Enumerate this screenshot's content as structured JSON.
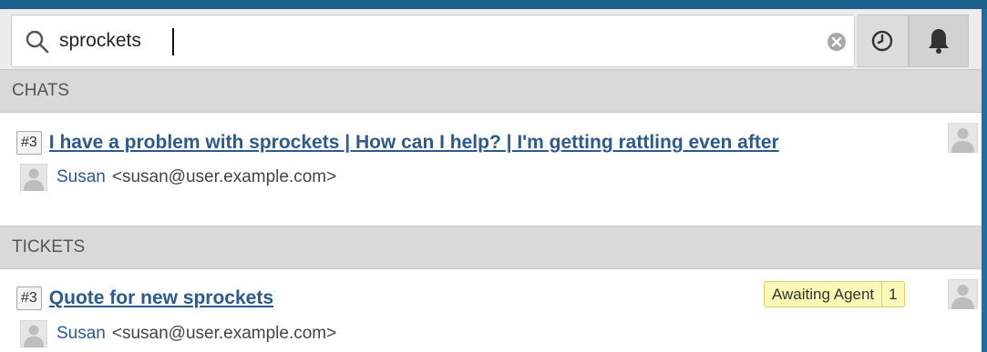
{
  "search": {
    "value": "sprockets",
    "clear_icon": "clear-circle-icon",
    "search_icon": "magnifier-icon",
    "history_icon": "clock-icon",
    "notifications_icon": "bell-icon"
  },
  "sections": {
    "chats": {
      "header": "CHATS",
      "items": [
        {
          "id": "#3",
          "title": "I have a problem with sprockets | How can I help? | I'm getting rattling even after",
          "person_name": "Susan",
          "person_email": "<susan@user.example.com>"
        }
      ]
    },
    "tickets": {
      "header": "TICKETS",
      "items": [
        {
          "id": "#3",
          "title": "Quote for new sprockets",
          "status_label": "Awaiting Agent",
          "status_count": "1",
          "person_name": "Susan",
          "person_email": "<susan@user.example.com>"
        }
      ]
    }
  },
  "colors": {
    "link": "#2d5a8e",
    "status_badge_bg": "#fbf7b6",
    "section_header_bg": "#d9d9d9",
    "accent": "#1f5f8b"
  }
}
